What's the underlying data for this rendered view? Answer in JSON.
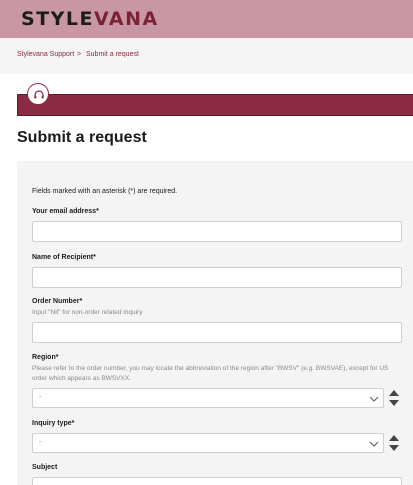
{
  "header": {
    "logo_part1": "STYLE",
    "logo_part2": "VANA"
  },
  "breadcrumb": {
    "item1": "Stylevana Support",
    "separator": ">",
    "item2": "Submit a request"
  },
  "page": {
    "title": "Submit a request"
  },
  "form": {
    "required_note": "Fields marked with an asterisk (*) are required.",
    "email_label": "Your email address*",
    "email_value": "",
    "recipient_label": "Name of Recipient*",
    "recipient_value": "",
    "order_label": "Order Number*",
    "order_help": "Input \"Nil\" for non-order related inquiry",
    "order_value": "",
    "region_label": "Region*",
    "region_help": "Please refer to the order number, you may locate the abbreviation of the region after \"BWSV\" (e.g. BWSVAE), except for US order which appears as BWSVXX.",
    "region_selected": "-",
    "inquiry_label": "Inquiry type*",
    "inquiry_selected": "-",
    "subject_label": "Subject",
    "subject_value": ""
  },
  "colors": {
    "header_bg": "#c996a3",
    "brand": "#8b2a43",
    "panel_bg": "#f4f4f4"
  },
  "icons": {
    "banner": "headset-icon",
    "select_arrow": "chevron-down-icon",
    "spinner": "up-down-arrows-icon"
  }
}
